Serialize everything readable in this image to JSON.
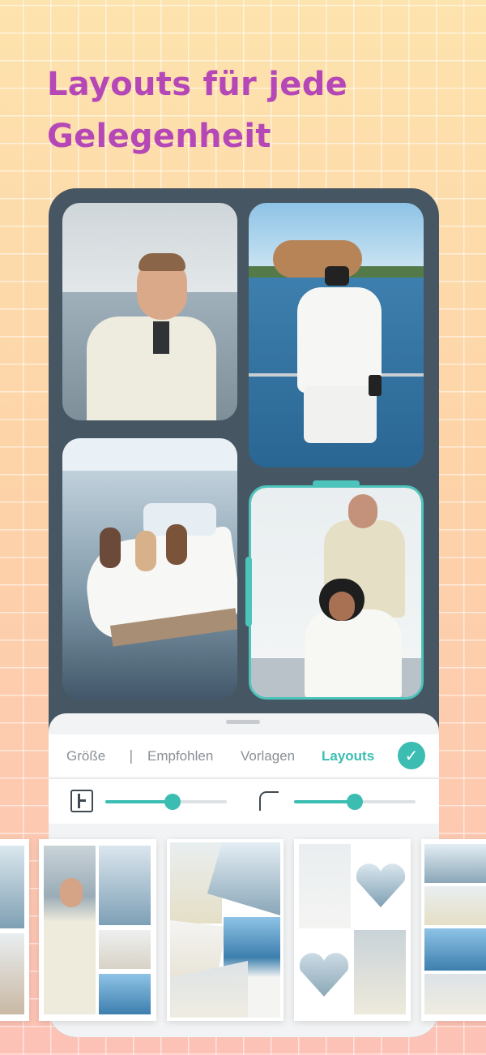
{
  "headline": {
    "line1": "Layouts für jede",
    "line2": "Gelegenheit"
  },
  "colors": {
    "accent": "#3bbdb2",
    "headline": "#b548b6",
    "phone_frame": "#465763"
  },
  "tabs": {
    "size": "Größe",
    "separator": "|",
    "recommended": "Empfohlen",
    "templates": "Vorlagen",
    "layouts": "Layouts"
  },
  "sliders": {
    "spacing_icon": "spacing-icon",
    "corner_icon": "corner-radius-icon",
    "spacing_value": 0.55,
    "corner_value": 0.5
  },
  "icons": {
    "confirm": "checkmark-icon"
  }
}
